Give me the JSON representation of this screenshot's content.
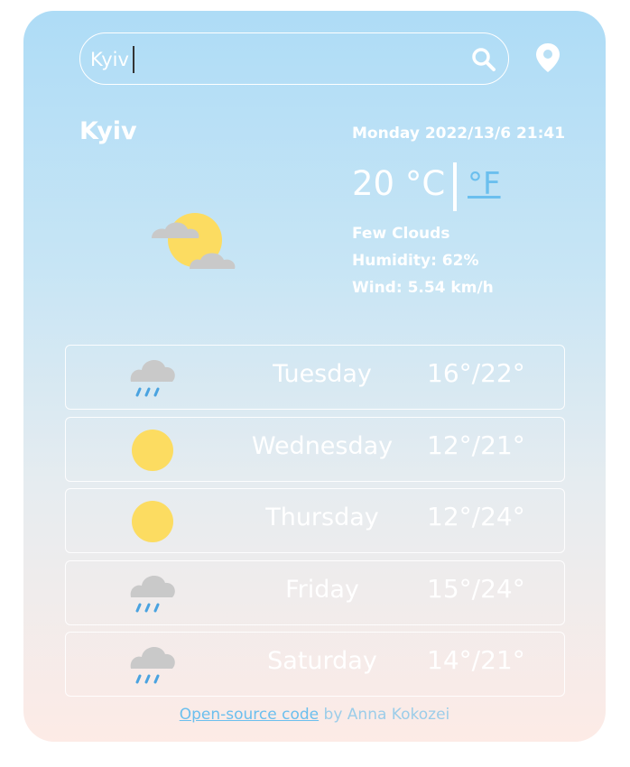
{
  "search": {
    "value": "Kyiv"
  },
  "current": {
    "city": "Kyiv",
    "datetime": "Monday 2022/13/6 21:41",
    "temp_c": "20 °C",
    "unit_f": "°F",
    "description": "Few Clouds",
    "humidity": "Humidity: 62%",
    "wind": "Wind: 5.54 km/h",
    "icon": "few-clouds-icon"
  },
  "forecast": [
    {
      "day": "Tuesday",
      "temp": "16°/22°",
      "icon": "rain-icon"
    },
    {
      "day": "Wednesday",
      "temp": "12°/21°",
      "icon": "sun-icon"
    },
    {
      "day": "Thursday",
      "temp": "12°/24°",
      "icon": "sun-icon"
    },
    {
      "day": "Friday",
      "temp": "15°/24°",
      "icon": "rain-icon"
    },
    {
      "day": "Saturday",
      "temp": "14°/21°",
      "icon": "rain-icon"
    }
  ],
  "footer": {
    "link_text": "Open-source code",
    "by_text": " by Anna Kokozei"
  },
  "colors": {
    "accent": "#6bbfee",
    "sun": "#fcdc61",
    "cloud": "#c9c9c9",
    "rain": "#4aa3e0"
  }
}
